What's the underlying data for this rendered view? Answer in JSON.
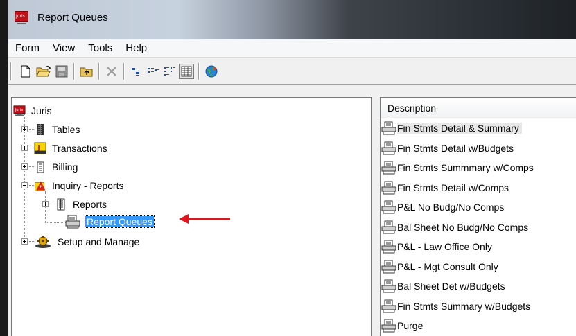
{
  "window": {
    "title": "Report Queues",
    "app_icon_text": "Juris"
  },
  "menu": [
    "Form",
    "View",
    "Tools",
    "Help"
  ],
  "toolbar": {
    "buttons": [
      "new-icon",
      "open-icon",
      "save-icon",
      "up-folder-icon",
      "delete-icon",
      "large-icons-icon",
      "small-icons-icon",
      "list-icon",
      "details-icon",
      "web-icon"
    ],
    "pressed": "details-icon"
  },
  "tree": {
    "root": "Juris",
    "items": [
      "Tables",
      "Transactions",
      "Billing",
      "Inquiry - Reports",
      "Reports",
      "Report Queues",
      "Setup and Manage"
    ],
    "selected": "Report Queues"
  },
  "list": {
    "header": "Description",
    "rows": [
      "Fin Stmts Detail & Summary",
      "Fin Stmts Detail w/Budgets",
      "Fin Stmts Summmary w/Comps",
      "Fin Stmts Detail w/Comps",
      "P&L No Budg/No Comps",
      "Bal Sheet No Budg/No Comps",
      "P&L - Law Office Only",
      "P&L  - Mgt Consult Only",
      "Bal Sheet Det w/Budgets",
      "Fin Stmts Summary w/Budgets",
      "Purge"
    ]
  },
  "colors": {
    "selection": "#3399ff",
    "annotation_arrow": "#e0141c"
  }
}
